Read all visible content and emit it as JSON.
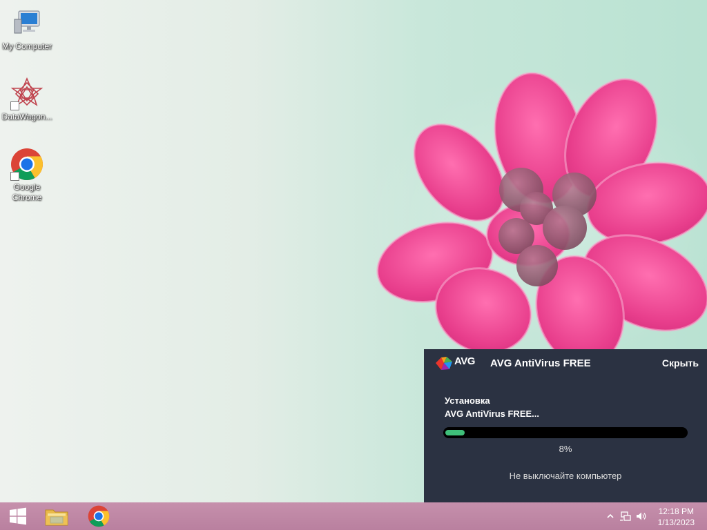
{
  "desktop": {
    "icons": [
      {
        "label": "My Computer",
        "icon": "computer-icon"
      },
      {
        "label": "DataWagon...",
        "icon": "datawagon-icon"
      },
      {
        "label": "Google Chrome",
        "icon": "chrome-icon"
      }
    ]
  },
  "avg_popup": {
    "logo_text": "AVG",
    "title": "AVG AntiVirus FREE",
    "hide_label": "Скрыть",
    "status_line1": "Установка",
    "status_line2": "AVG AntiVirus FREE...",
    "progress_percent": 8,
    "progress_label": "8%",
    "warning": "Не выключайте компьютер",
    "colors": {
      "background": "#2b3242",
      "progress": "#3fbf7a"
    }
  },
  "taskbar": {
    "items": [
      {
        "icon": "windows-start-icon"
      },
      {
        "icon": "file-explorer-icon"
      },
      {
        "icon": "chrome-icon"
      }
    ],
    "tray": {
      "icons": [
        "show-hidden-icons-chevron-icon",
        "network-icon",
        "volume-icon"
      ],
      "time": "12:18 PM",
      "date": "1/13/2023"
    },
    "color": "#c08aa7"
  }
}
